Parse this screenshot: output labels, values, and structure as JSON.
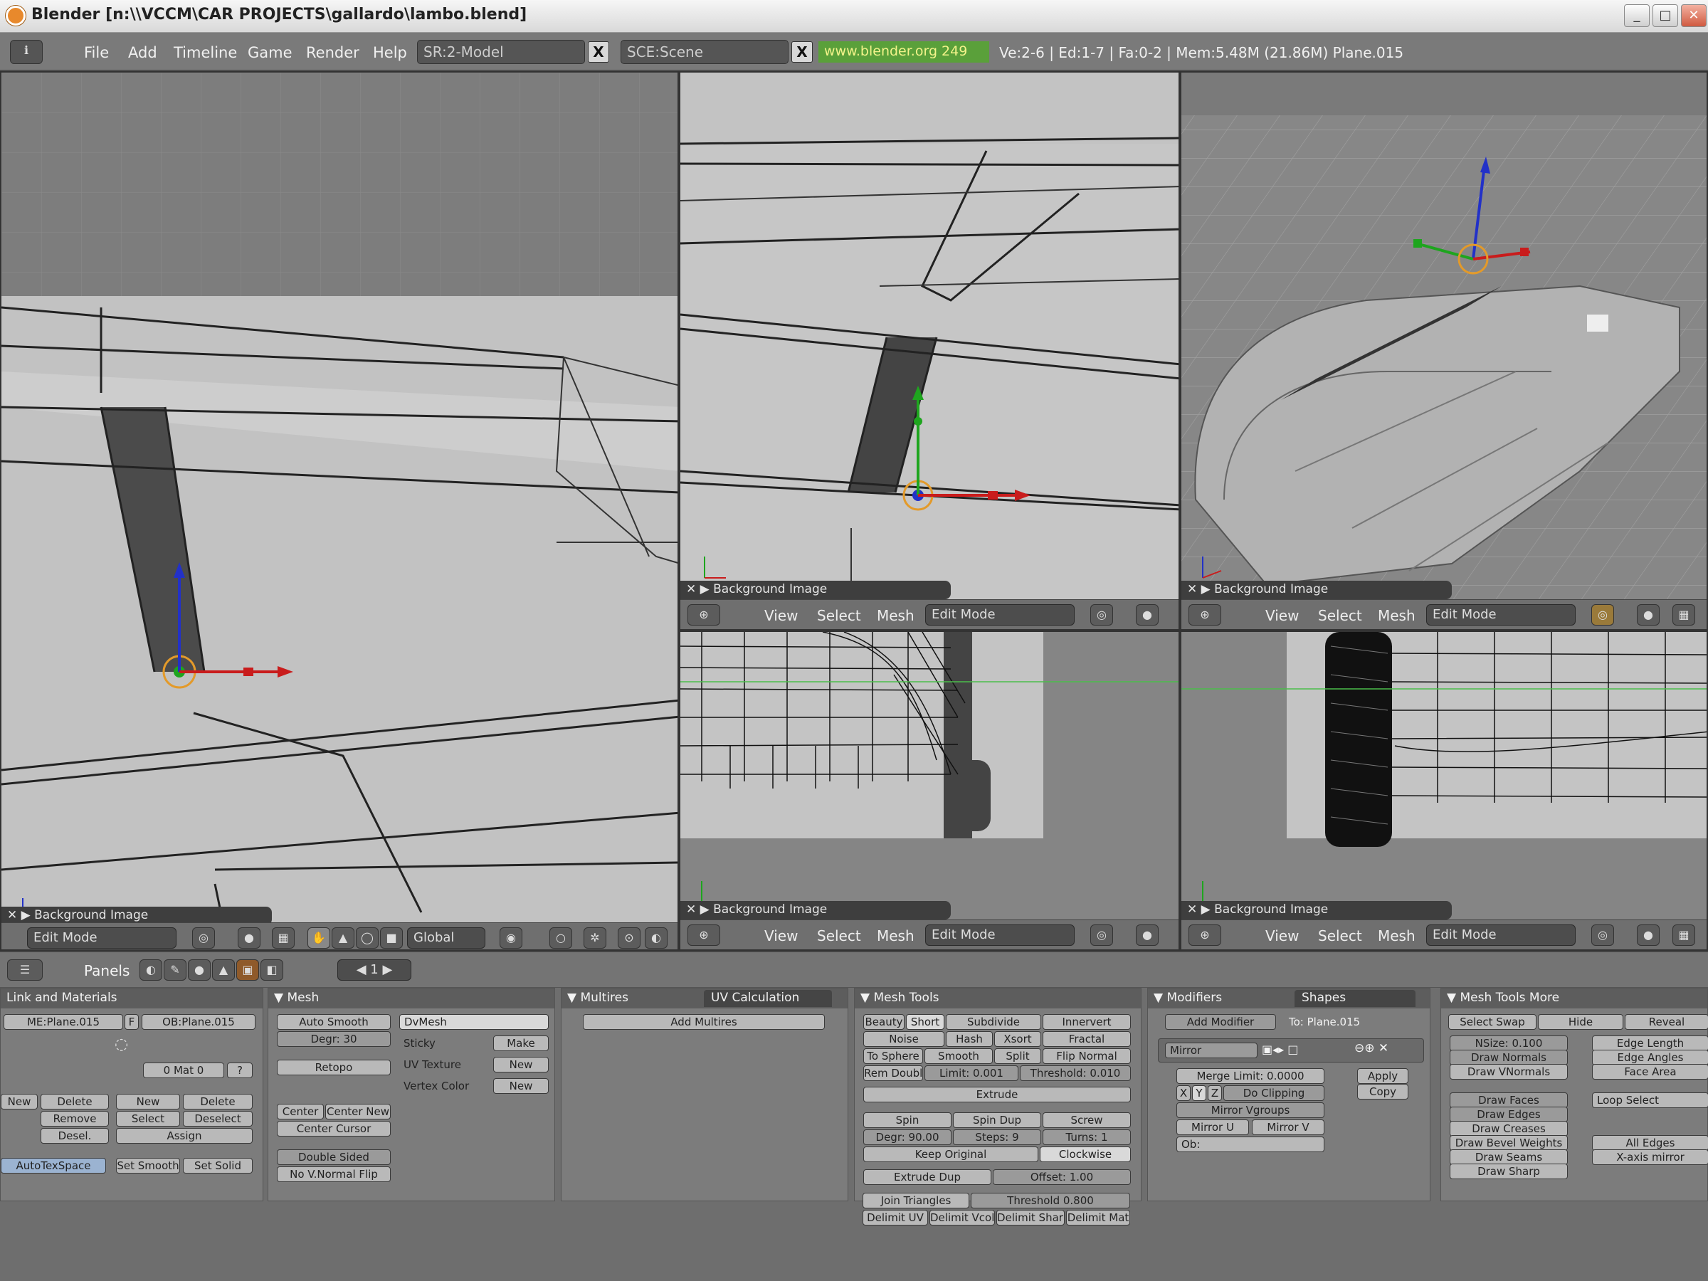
{
  "window": {
    "title": "Blender [n:\\\\VCCM\\CAR PROJECTS\\gallardo\\lambo.blend]",
    "minimize": "_",
    "maximize": "□",
    "close": "✕"
  },
  "header": {
    "menus": [
      "File",
      "Add",
      "Timeline",
      "Game",
      "Render",
      "Help"
    ],
    "screen_field": "SR:2-Model",
    "scene_field": "SCE:Scene",
    "url": "www.blender.org 249",
    "stats": "Ve:2-6 | Ed:1-7 | Fa:0-2 | Mem:5.48M (21.86M) Plane.015",
    "close_glyph": "X"
  },
  "viewports": {
    "bg_label": "Background Image",
    "menus": [
      "View",
      "Select",
      "Mesh"
    ],
    "mode": "Edit Mode",
    "orientation": "Global",
    "frame": "1"
  },
  "buttons_header": {
    "panels_label": "Panels"
  },
  "panels": {
    "link_materials": {
      "title": "Link and Materials",
      "me": "ME:Plane.015",
      "f": "F",
      "ob": "OB:Plane.015",
      "mat": "0 Mat 0",
      "q": "?",
      "new": "New",
      "delete": "Delete",
      "remove": "Remove",
      "desel": "Desel.",
      "new2": "New",
      "delete2": "Delete",
      "select": "Select",
      "deselect": "Deselect",
      "assign": "Assign",
      "autotex": "AutoTexSpace",
      "set_smooth": "Set Smooth",
      "set_solid": "Set Solid"
    },
    "mesh": {
      "title": "Mesh",
      "auto_smooth": "Auto Smooth",
      "degr": "Degr: 30",
      "retopo": "Retopo",
      "center": "Center",
      "center_new": "Center New",
      "center_cursor": "Center Cursor",
      "double_sided": "Double Sided",
      "no_v_normal_flip": "No V.Normal Flip",
      "dvert": "DvMesh",
      "sticky": "Sticky",
      "make": "Make",
      "uv_texture": "UV Texture",
      "new1": "New",
      "vertex_color": "Vertex Color",
      "new2": "New"
    },
    "multires": {
      "title": "Multires",
      "tab": "UV Calculation",
      "add": "Add Multires"
    },
    "mesh_tools": {
      "title": "Mesh Tools",
      "beauty": "Beauty",
      "short": "Short",
      "subdivide": "Subdivide",
      "innervert": "Innervert",
      "noise": "Noise",
      "hash": "Hash",
      "xsort": "Xsort",
      "fractal": "Fractal",
      "to_sphere": "To Sphere",
      "smooth": "Smooth",
      "split": "Split",
      "flip_normal": "Flip Normal",
      "rem_doubles": "Rem Doubles",
      "limit": "Limit: 0.001",
      "threshold1": "Threshold: 0.010",
      "extrude": "Extrude",
      "spin": "Spin",
      "spin_dup": "Spin Dup",
      "screw": "Screw",
      "degr": "Degr: 90.00",
      "steps": "Steps: 9",
      "turns": "Turns: 1",
      "keep_original": "Keep Original",
      "clockwise": "Clockwise",
      "extrude_dup": "Extrude Dup",
      "offset": "Offset: 1.00",
      "join_triangles": "Join Triangles",
      "threshold2": "Threshold 0.800",
      "delimit_uv": "Delimit UV",
      "delimit_vcol": "Delimit Vcol",
      "delimit_sharp": "Delimit Sharp",
      "delimit_mat": "Delimit Mat"
    },
    "modifiers": {
      "title": "Modifiers",
      "tab": "Shapes",
      "add": "Add Modifier",
      "to": "To: Plane.015",
      "mirror": "Mirror",
      "merge_limit": "Merge Limit: 0.0000",
      "x": "X",
      "y": "Y",
      "z": "Z",
      "do_clipping": "Do Clipping",
      "mirror_vgroups": "Mirror Vgroups",
      "mirror_u": "Mirror U",
      "mirror_v": "Mirror V",
      "ob": "Ob:",
      "apply": "Apply",
      "copy": "Copy"
    },
    "mesh_tools_more": {
      "title": "Mesh Tools More",
      "select_swap": "Select Swap",
      "hide": "Hide",
      "reveal": "Reveal",
      "nsize": "NSize: 0.100",
      "draw_normals": "Draw Normals",
      "draw_vnormals": "Draw VNormals",
      "draw_faces": "Draw Faces",
      "draw_edges": "Draw Edges",
      "draw_creases": "Draw Creases",
      "draw_bevel": "Draw Bevel Weights",
      "draw_seams": "Draw Seams",
      "draw_sharp": "Draw Sharp",
      "edge_length": "Edge Length",
      "edge_angles": "Edge Angles",
      "face_area": "Face Area",
      "loop_select": "Loop Select",
      "all_edges": "All Edges",
      "xaxis_mirror": "X-axis mirror"
    }
  }
}
